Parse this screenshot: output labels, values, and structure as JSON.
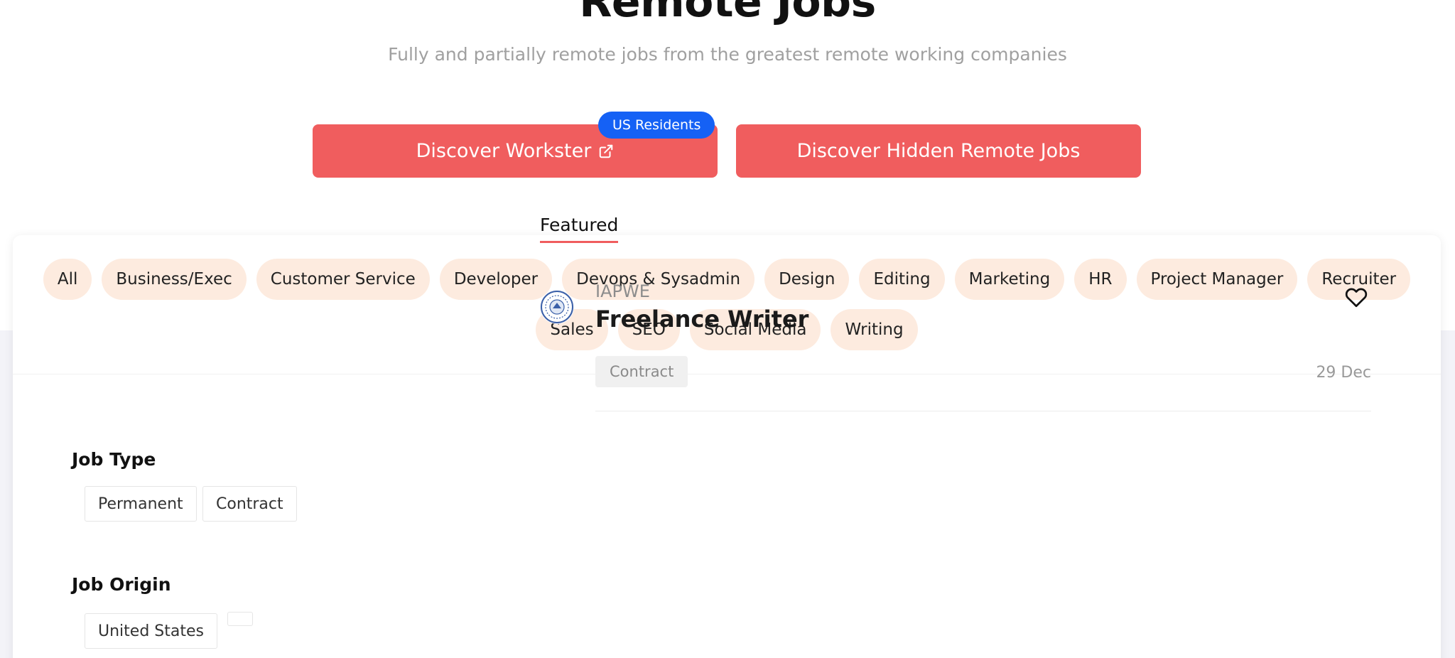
{
  "hero": {
    "title": "Remote Jobs",
    "subtitle": "Fully and partially remote jobs from the greatest remote working companies"
  },
  "cta": {
    "workster_label": "Discover Workster",
    "workster_badge": "US Residents",
    "hidden_label": "Discover Hidden Remote Jobs"
  },
  "categories": [
    "All",
    "Business/Exec",
    "Customer Service",
    "Developer",
    "Devops & Sysadmin",
    "Design",
    "Editing",
    "Marketing",
    "HR",
    "Project Manager",
    "Recruiter",
    "Sales",
    "SEO",
    "Social Media",
    "Writing"
  ],
  "filters": {
    "job_type": {
      "title": "Job Type",
      "options": [
        "Permanent",
        "Contract"
      ]
    },
    "job_origin": {
      "title": "Job Origin",
      "options": [
        "United States",
        ""
      ]
    }
  },
  "listing": {
    "tab": "Featured",
    "jobs": [
      {
        "company": "IAPWE",
        "title": "Freelance Writer",
        "type": "Contract",
        "date": "29 Dec"
      }
    ]
  },
  "colors": {
    "accent": "#f05d5e",
    "badge": "#1561f5",
    "chip_bg": "#fdebdf"
  }
}
